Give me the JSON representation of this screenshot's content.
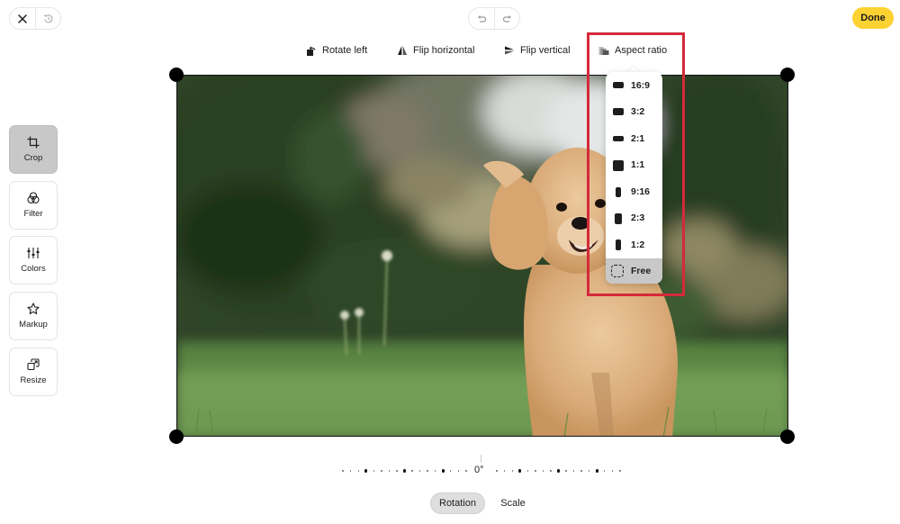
{
  "window": {
    "close_icon": "close-icon",
    "history_icon": "history-revert-icon",
    "undo_icon": "undo-icon",
    "redo_icon": "redo-icon",
    "done_label": "Done",
    "accent_color": "#fcd232"
  },
  "toolbar": {
    "items": [
      {
        "label": "Rotate left",
        "icon": "rotate-left-icon"
      },
      {
        "label": "Flip horizontal",
        "icon": "flip-horizontal-icon"
      },
      {
        "label": "Flip vertical",
        "icon": "flip-vertical-icon"
      },
      {
        "label": "Aspect ratio",
        "icon": "aspect-ratio-icon"
      }
    ]
  },
  "aspect_menu": {
    "open": true,
    "selected": "Free",
    "options": [
      {
        "label": "16:9",
        "icon": "landscape-16-9-icon"
      },
      {
        "label": "3:2",
        "icon": "landscape-3-2-icon"
      },
      {
        "label": "2:1",
        "icon": "landscape-2-1-icon"
      },
      {
        "label": "1:1",
        "icon": "square-icon"
      },
      {
        "label": "9:16",
        "icon": "portrait-9-16-icon"
      },
      {
        "label": "2:3",
        "icon": "portrait-2-3-icon"
      },
      {
        "label": "1:2",
        "icon": "portrait-1-2-icon"
      },
      {
        "label": "Free",
        "icon": "free-dashed-icon"
      }
    ],
    "highlight_color": "#d42a3a"
  },
  "sidebar": {
    "active": "Crop",
    "items": [
      {
        "label": "Crop",
        "icon": "crop-icon"
      },
      {
        "label": "Filter",
        "icon": "filter-icon"
      },
      {
        "label": "Colors",
        "icon": "sliders-icon"
      },
      {
        "label": "Markup",
        "icon": "star-icon"
      },
      {
        "label": "Resize",
        "icon": "resize-icon"
      }
    ]
  },
  "canvas": {
    "image_description": "Fluffy apricot toy poodle running on grass with blurred green trees behind"
  },
  "rotation": {
    "value_label": "0°",
    "value_degrees": 0
  },
  "bottom_tabs": {
    "active": "Rotation",
    "items": [
      {
        "label": "Rotation"
      },
      {
        "label": "Scale"
      }
    ]
  }
}
